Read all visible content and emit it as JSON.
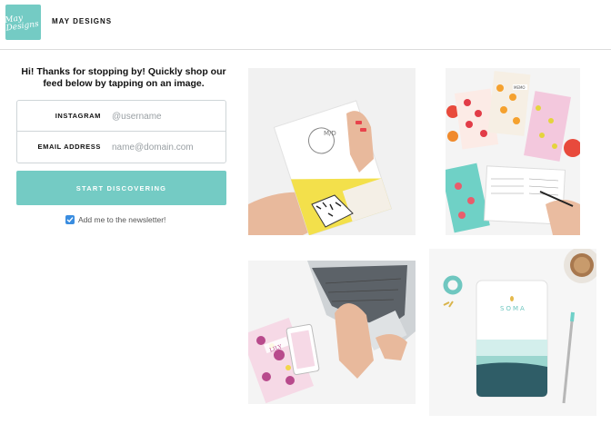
{
  "header": {
    "logo_text": "May Designs",
    "brand": "MAY DESIGNS"
  },
  "intro": {
    "text": "Hi! Thanks for stopping by! Quickly shop our feed below by tapping on an image."
  },
  "form": {
    "instagram_label": "INSTAGRAM",
    "instagram_placeholder": "@username",
    "email_label": "EMAIL ADDRESS",
    "email_placeholder": "name@domain.com",
    "cta_label": "START DISCOVERING",
    "newsletter_label": "Add me to the newsletter!",
    "newsletter_checked": true
  },
  "gallery": {
    "tiles": [
      {
        "subject": "hand holding yellow geometric notebook",
        "mark_text": "M/D"
      },
      {
        "subject": "fruit pattern notebooks and planner",
        "mark_text": "MEMO"
      },
      {
        "subject": "laptop with floral phone and notebook",
        "mark_text": "LILY"
      },
      {
        "subject": "SOMA notebook with coffee and washi tape",
        "mark_text": "SOMA"
      }
    ]
  },
  "colors": {
    "accent": "#74cbc4",
    "checkbox": "#3a8de0"
  }
}
